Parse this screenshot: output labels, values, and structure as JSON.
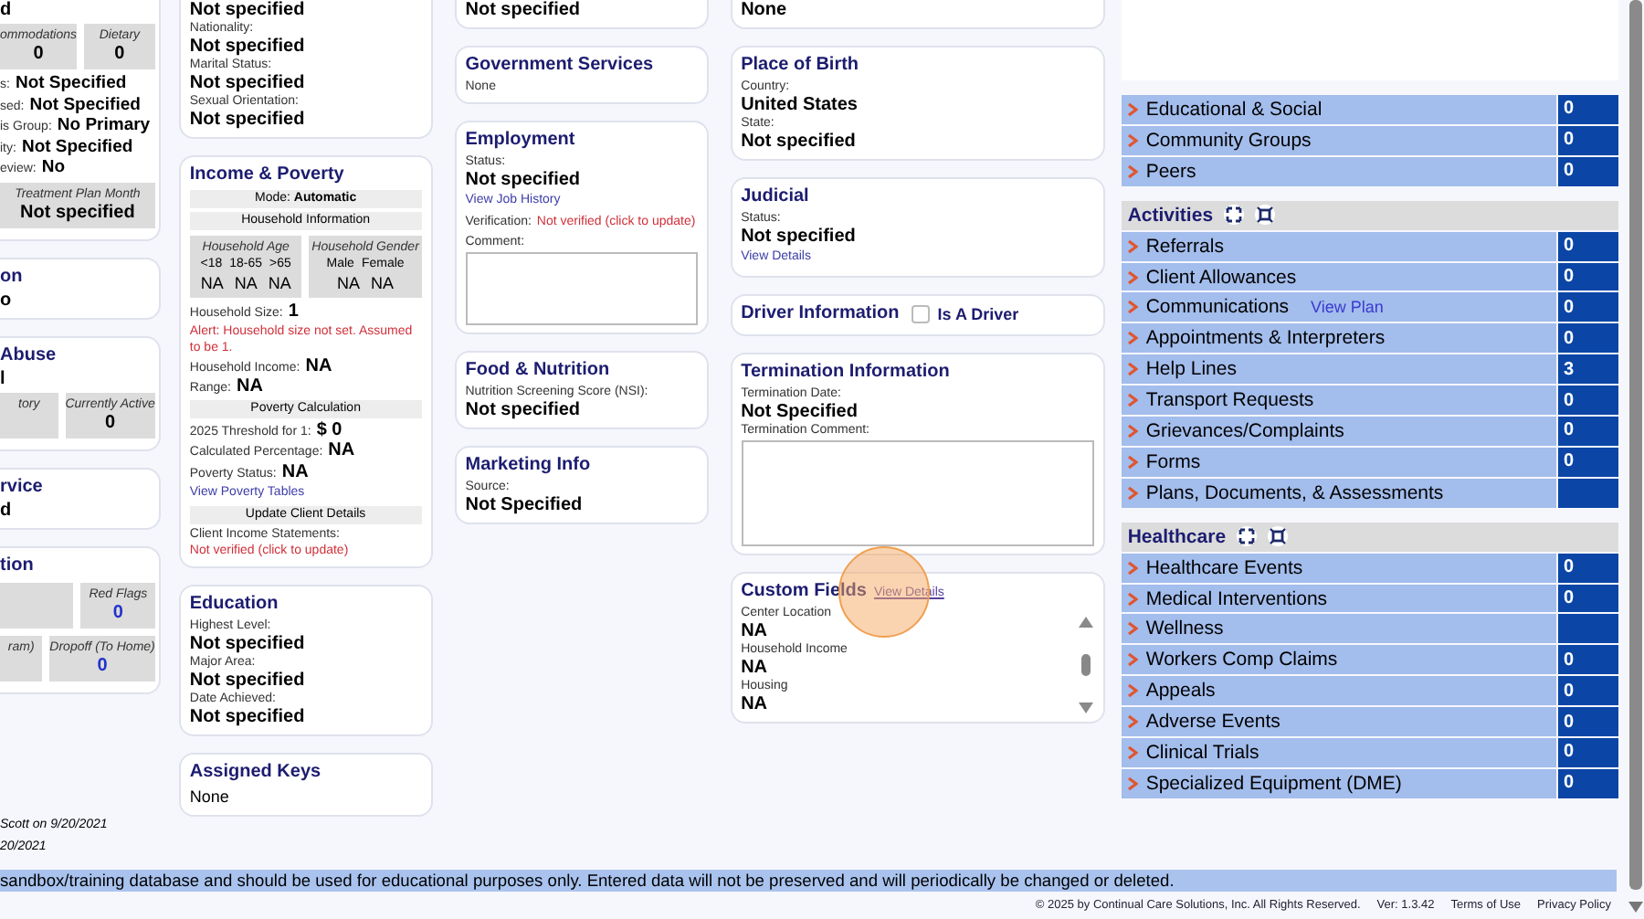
{
  "columns": [
    {
      "cards": [
        {
          "items": [
            {
              "kind": "value",
              "text": "d"
            },
            {
              "kind": "boxes",
              "boxes": [
                {
                  "title": "ommodations",
                  "value": "0",
                  "kind": "plain"
                },
                {
                  "title": "Dietary",
                  "value": "0",
                  "kind": "plain"
                }
              ]
            },
            {
              "kind": "pair",
              "label": "s:",
              "value": "Not Specified"
            },
            {
              "kind": "pair",
              "label": "sed:",
              "value": "Not Specified"
            },
            {
              "kind": "pair",
              "label": "is Group:",
              "value": "No Primary"
            },
            {
              "kind": "pair",
              "label": "ity:",
              "value": "Not Specified"
            },
            {
              "kind": "pair",
              "label": "eview:",
              "value": "No"
            },
            {
              "kind": "boxes",
              "boxes": [
                {
                  "title": "Treatment Plan Month",
                  "value": "Not specified",
                  "kind": "plain"
                }
              ]
            }
          ]
        },
        {
          "title": "on",
          "items": [
            {
              "kind": "value",
              "text": "o"
            }
          ]
        },
        {
          "title": "Abuse",
          "items": [
            {
              "kind": "value",
              "text": "l"
            },
            {
              "kind": "boxes",
              "boxes": [
                {
                  "title": "tory",
                  "kind": "plain"
                },
                {
                  "title": "Currently Active",
                  "value": "0",
                  "kind": "plain"
                }
              ]
            }
          ]
        },
        {
          "title": "rvice",
          "items": [
            {
              "kind": "value",
              "text": "d"
            }
          ]
        },
        {
          "title": "tion",
          "items": [
            {
              "kind": "boxes",
              "boxes": [
                {
                  "kind": "blank"
                },
                {
                  "title": "Red Flags",
                  "value": "0",
                  "kind": "link"
                }
              ]
            },
            {
              "kind": "boxes",
              "boxes": [
                {
                  "title": "ram)",
                  "kind": "plain"
                },
                {
                  "title": "Dropoff (To Home)",
                  "value": "0",
                  "kind": "link"
                }
              ]
            }
          ]
        }
      ],
      "notes": [
        "Scott on 9/20/2021",
        "20/2021"
      ]
    },
    {
      "cards": [
        {
          "items": [
            {
              "kind": "value",
              "text": "Not specified"
            },
            {
              "kind": "label",
              "text": "Nationality:"
            },
            {
              "kind": "value",
              "text": "Not specified"
            },
            {
              "kind": "label",
              "text": "Marital Status:"
            },
            {
              "kind": "value",
              "text": "Not specified"
            },
            {
              "kind": "label",
              "text": "Sexual Orientation:"
            },
            {
              "kind": "value",
              "text": "Not specified"
            }
          ]
        },
        {
          "title": "Income & Poverty",
          "items": [
            {
              "kind": "band",
              "text": "Mode: **Automatic**"
            },
            {
              "kind": "band",
              "text": "Household Information"
            },
            {
              "kind": "boxes",
              "boxes": [
                {
                  "title": "Household Age",
                  "headers": [
                    "<18",
                    "18-65",
                    ">65"
                  ],
                  "values": [
                    "NA",
                    "NA",
                    "NA"
                  ],
                  "kind": "plain"
                },
                {
                  "title": "Household Gender",
                  "headers": [
                    "Male",
                    "Female"
                  ],
                  "values": [
                    "NA",
                    "NA"
                  ],
                  "kind": "plain"
                }
              ]
            },
            {
              "kind": "pair",
              "label": "Household Size:",
              "value": "1"
            },
            {
              "kind": "alert",
              "text": "Alert: Household size not set. Assumed to be 1."
            },
            {
              "kind": "pair",
              "label": "Household Income:",
              "value": "NA"
            },
            {
              "kind": "pair",
              "label": "Range:",
              "value": "NA"
            },
            {
              "kind": "band",
              "text": "Poverty Calculation"
            },
            {
              "kind": "pair",
              "label": "2025 Threshold for 1:",
              "value": "$ 0"
            },
            {
              "kind": "pair",
              "label": "Calculated Percentage:",
              "value": "NA"
            },
            {
              "kind": "pair",
              "label": "Poverty Status:",
              "value": "NA"
            },
            {
              "kind": "link",
              "text": "View Poverty Tables"
            },
            {
              "kind": "band",
              "text": "Update Client Details"
            },
            {
              "kind": "label",
              "text": "Client Income Statements:"
            },
            {
              "kind": "alert",
              "text": "Not verified (click to update)"
            }
          ]
        },
        {
          "title": "Education",
          "items": [
            {
              "kind": "label",
              "text": "Highest Level:"
            },
            {
              "kind": "value",
              "text": "Not specified"
            },
            {
              "kind": "label",
              "text": "Major Area:"
            },
            {
              "kind": "value",
              "text": "Not specified"
            },
            {
              "kind": "label",
              "text": "Date Achieved:"
            },
            {
              "kind": "value",
              "text": "Not specified"
            }
          ]
        },
        {
          "title": "Assigned Keys",
          "items": [
            {
              "kind": "text",
              "text": "None"
            }
          ]
        }
      ]
    },
    {
      "cards": [
        {
          "items": [
            {
              "kind": "value",
              "text": "Not specified"
            }
          ]
        },
        {
          "title": "Government Services",
          "items": [
            {
              "kind": "small",
              "text": "None"
            }
          ]
        },
        {
          "title": "Employment",
          "items": [
            {
              "kind": "label",
              "text": "Status:"
            },
            {
              "kind": "value",
              "text": "Not specified"
            },
            {
              "kind": "link",
              "text": "View Job History"
            },
            {
              "kind": "pair_alert",
              "label": "Verification:",
              "value": "Not verified (click to update)"
            },
            {
              "kind": "label",
              "text": "Comment:"
            },
            {
              "kind": "textarea"
            }
          ]
        },
        {
          "title": "Food & Nutrition",
          "items": [
            {
              "kind": "label",
              "text": "Nutrition Screening Score (NSI):"
            },
            {
              "kind": "value",
              "text": "Not specified"
            }
          ]
        },
        {
          "title": "Marketing Info",
          "items": [
            {
              "kind": "label",
              "text": "Source:"
            },
            {
              "kind": "value",
              "text": "Not Specified"
            }
          ]
        }
      ]
    },
    {
      "cards": [
        {
          "items": [
            {
              "kind": "value",
              "text": "None"
            }
          ]
        },
        {
          "title": "Place of Birth",
          "items": [
            {
              "kind": "label",
              "text": "Country:"
            },
            {
              "kind": "value",
              "text": "United States"
            },
            {
              "kind": "label",
              "text": "State:"
            },
            {
              "kind": "value",
              "text": "Not specified"
            }
          ]
        },
        {
          "title": "Judicial",
          "items": [
            {
              "kind": "label",
              "text": "Status:"
            },
            {
              "kind": "value",
              "text": "Not specified"
            },
            {
              "kind": "link",
              "text": "View Details"
            }
          ]
        },
        {
          "title": "Driver Information",
          "checkbox": {
            "label": "Is A Driver",
            "checked": false
          }
        },
        {
          "title": "Termination Information",
          "items": [
            {
              "kind": "label",
              "text": "Termination Date:"
            },
            {
              "kind": "value",
              "text": "Not Specified"
            },
            {
              "kind": "label",
              "text": "Termination Comment:"
            },
            {
              "kind": "textarea"
            }
          ]
        },
        {
          "title": "Custom Fields",
          "title_link": "View Details",
          "scrollable": true,
          "click_marker": true,
          "items": [
            {
              "kind": "label",
              "text": "Center Location"
            },
            {
              "kind": "value",
              "text": "NA"
            },
            {
              "kind": "label",
              "text": "Household Income"
            },
            {
              "kind": "value",
              "text": "NA"
            },
            {
              "kind": "label",
              "text": "Housing"
            },
            {
              "kind": "value",
              "text": "NA"
            }
          ]
        }
      ]
    }
  ],
  "panel": {
    "groups": [
      {
        "rows": [
          {
            "label": "Educational & Social",
            "count": "0"
          },
          {
            "label": "Community Groups",
            "count": "0"
          },
          {
            "label": "Peers",
            "count": "0"
          }
        ]
      },
      {
        "title": "Activities",
        "rows": [
          {
            "label": "Referrals",
            "count": "0"
          },
          {
            "label": "Client Allowances",
            "count": "0"
          },
          {
            "label": "Communications",
            "link": "View Plan",
            "count": "0"
          },
          {
            "label": "Appointments & Interpreters",
            "count": "0"
          },
          {
            "label": "Help Lines",
            "count": "3"
          },
          {
            "label": "Transport Requests",
            "count": "0"
          },
          {
            "label": "Grievances/Complaints",
            "count": "0"
          },
          {
            "label": "Forms",
            "count": "0"
          },
          {
            "label": "Plans, Documents, & Assessments"
          }
        ]
      },
      {
        "title": "Healthcare",
        "rows": [
          {
            "label": "Healthcare Events",
            "count": "0"
          },
          {
            "label": "Medical Interventions",
            "count": "0"
          },
          {
            "label": "Wellness"
          },
          {
            "label": "Workers Comp Claims",
            "count": "0"
          },
          {
            "label": "Appeals",
            "count": "0"
          },
          {
            "label": "Adverse Events",
            "count": "0"
          },
          {
            "label": "Clinical Trials",
            "count": "0"
          },
          {
            "label": "Specialized Equipment (DME)",
            "count": "0"
          }
        ]
      }
    ]
  },
  "banner": "sandbox/training database and should be used for educational purposes only. Entered data will not be preserved and will periodically be changed or deleted.",
  "footer": {
    "copyright": "© 2025 by Continual Care Solutions, Inc. All Rights Reserved.",
    "version": "Ver: 1.3.42",
    "links": [
      "Terms of Use",
      "Privacy Policy"
    ]
  }
}
